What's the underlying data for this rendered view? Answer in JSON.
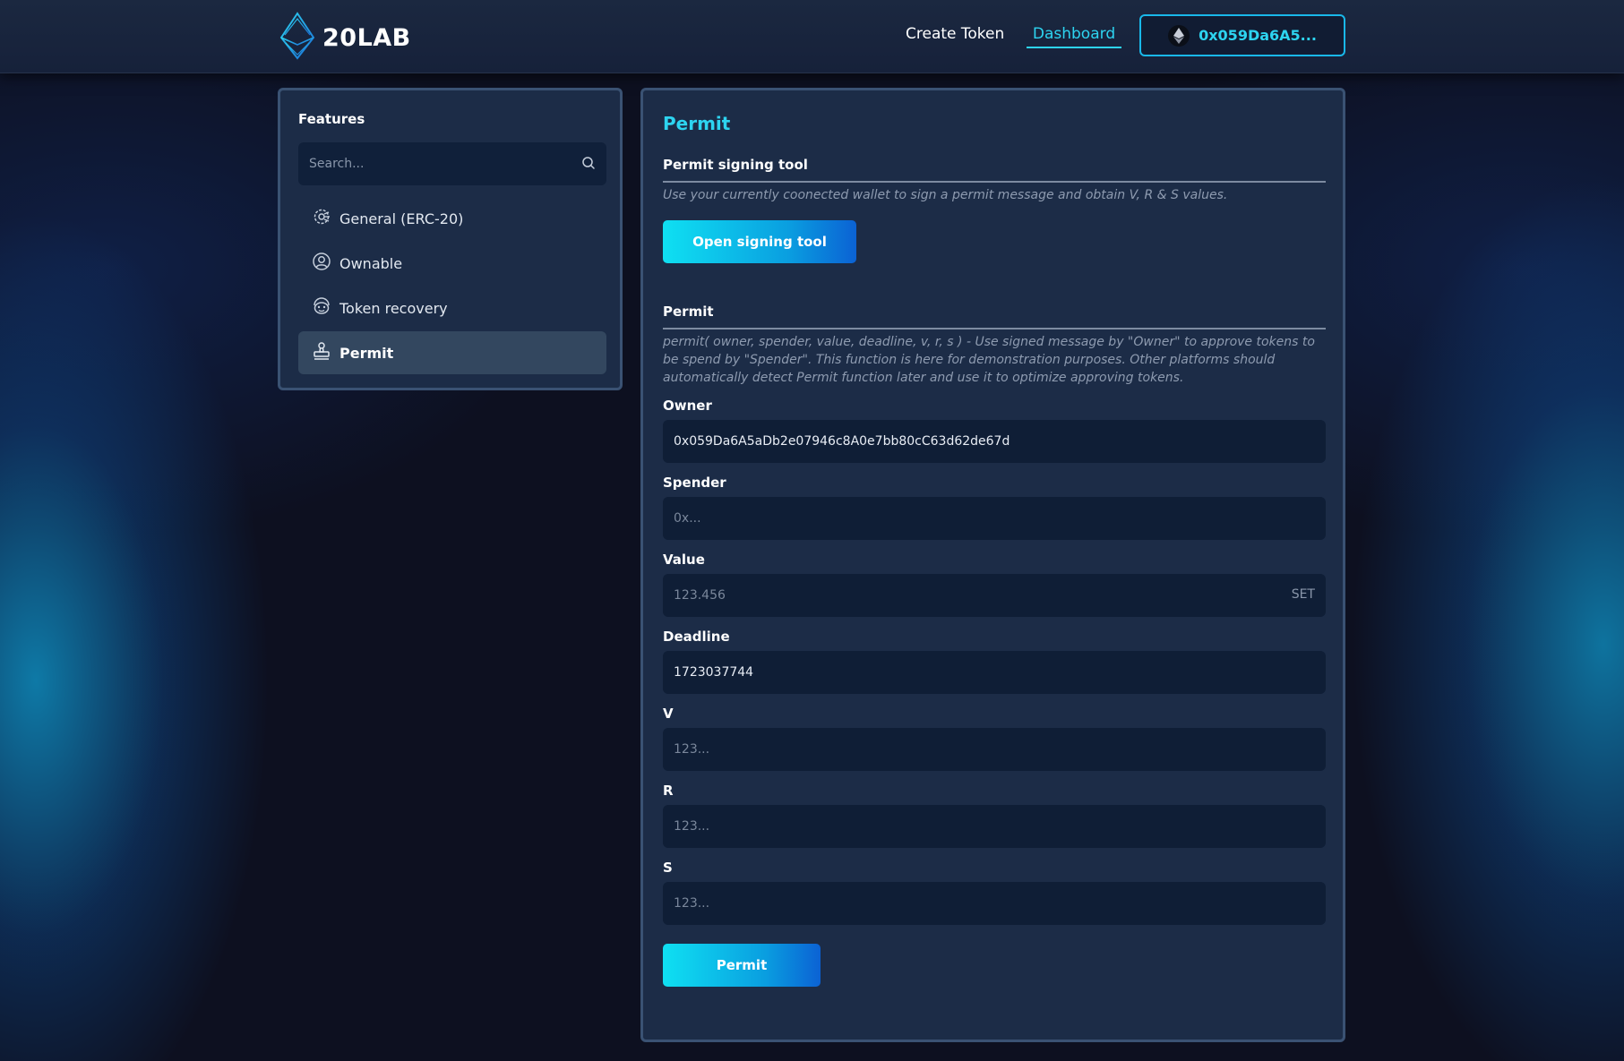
{
  "header": {
    "logo_text": "20LAB",
    "nav": {
      "create_token": "Create Token",
      "dashboard": "Dashboard"
    },
    "wallet": {
      "address": "0x059Da6A5...",
      "icon": "ethereum-icon"
    }
  },
  "sidebar": {
    "title": "Features",
    "search": {
      "placeholder": "Search...",
      "value": ""
    },
    "items": [
      {
        "label": "General (ERC-20)",
        "icon": "gear-chip-icon",
        "active": false
      },
      {
        "label": "Ownable",
        "icon": "user-circle-icon",
        "active": false
      },
      {
        "label": "Token recovery",
        "icon": "recovery-icon",
        "active": false
      },
      {
        "label": "Permit",
        "icon": "stamp-icon",
        "active": true
      }
    ]
  },
  "main": {
    "title": "Permit",
    "signing": {
      "title": "Permit signing tool",
      "description": "Use your currently coonected wallet to sign a permit message and obtain V, R & S values.",
      "button": "Open signing tool"
    },
    "permit": {
      "title": "Permit",
      "description": "permit( owner, spender, value, deadline, v, r, s ) - Use signed message by \"Owner\" to approve tokens to be spend by \"Spender\". This function is here for demonstration purposes. Other platforms should automatically detect Permit function later and use it to optimize approving tokens.",
      "fields": {
        "owner": {
          "label": "Owner",
          "value": "0x059Da6A5aDb2e07946c8A0e7bb80cC63d62de67d",
          "placeholder": ""
        },
        "spender": {
          "label": "Spender",
          "value": "",
          "placeholder": "0x..."
        },
        "value": {
          "label": "Value",
          "value": "",
          "placeholder": "123.456",
          "suffix": "SET"
        },
        "deadline": {
          "label": "Deadline",
          "value": "1723037744",
          "placeholder": ""
        },
        "v": {
          "label": "V",
          "value": "",
          "placeholder": "123..."
        },
        "r": {
          "label": "R",
          "value": "",
          "placeholder": "123..."
        },
        "s": {
          "label": "S",
          "value": "",
          "placeholder": "123..."
        }
      },
      "button": "Permit"
    }
  },
  "colors": {
    "accent": "#2dd4f0",
    "panel": "#1c2c47",
    "input": "#0f1e36",
    "active_item": "#33475f"
  }
}
